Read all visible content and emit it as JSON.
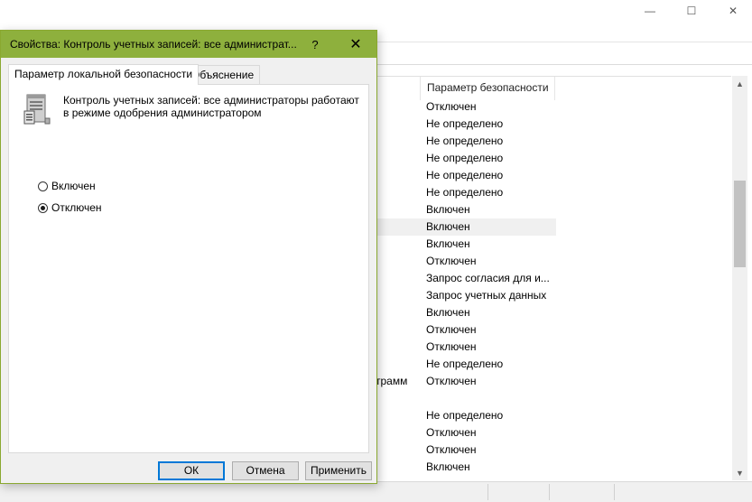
{
  "main_window": {
    "controls": {
      "minimize_glyph": "—",
      "maximize_glyph": "☐",
      "close_glyph": "✕"
    },
    "list": {
      "column_header": "Параметр безопасности",
      "rows": [
        {
          "name": "",
          "value": "Отключен"
        },
        {
          "name": "",
          "value": "Не определено"
        },
        {
          "name": "",
          "value": "Не определено"
        },
        {
          "name": "",
          "value": "Не определено"
        },
        {
          "name": "",
          "value": "Не определено"
        },
        {
          "name": "",
          "value": "Не определено"
        },
        {
          "name": "",
          "value": "Включен"
        },
        {
          "name": "",
          "value": "Включен",
          "selected": true
        },
        {
          "name": "",
          "value": "Включен"
        },
        {
          "name": "",
          "value": "Отключен"
        },
        {
          "name": "",
          "value": "Запрос согласия для и..."
        },
        {
          "name": "",
          "value": "Запрос учетных данных"
        },
        {
          "name": "",
          "value": "Включен"
        },
        {
          "name": "",
          "value": "Отключен"
        },
        {
          "name": "",
          "value": "Отключен"
        },
        {
          "name": "",
          "value": "Не определено"
        },
        {
          "name": "трамм",
          "value": "Отключен"
        },
        {
          "name": "",
          "value": ""
        },
        {
          "name": "",
          "value": "Не определено"
        },
        {
          "name": "",
          "value": "Отключен"
        },
        {
          "name": "",
          "value": "Отключен"
        },
        {
          "name": "",
          "value": "Включен"
        }
      ]
    }
  },
  "dialog": {
    "title": "Свойства: Контроль учетных записей: все администрат...",
    "help_glyph": "?",
    "close_glyph": "✕",
    "tabs": [
      {
        "label": "Параметр локальной безопасности",
        "active": true
      },
      {
        "label": "Объяснение",
        "active": false
      }
    ],
    "policy_name": "Контроль учетных записей: все администраторы работают в режиме одобрения администратором",
    "options": [
      {
        "label": "Включен",
        "checked": false
      },
      {
        "label": "Отключен",
        "checked": true
      }
    ],
    "buttons": {
      "ok": "ОК",
      "cancel": "Отмена",
      "apply": "Применить"
    },
    "colors": {
      "titlebar": "#8eb03d",
      "ok_border": "#0078d7"
    }
  }
}
